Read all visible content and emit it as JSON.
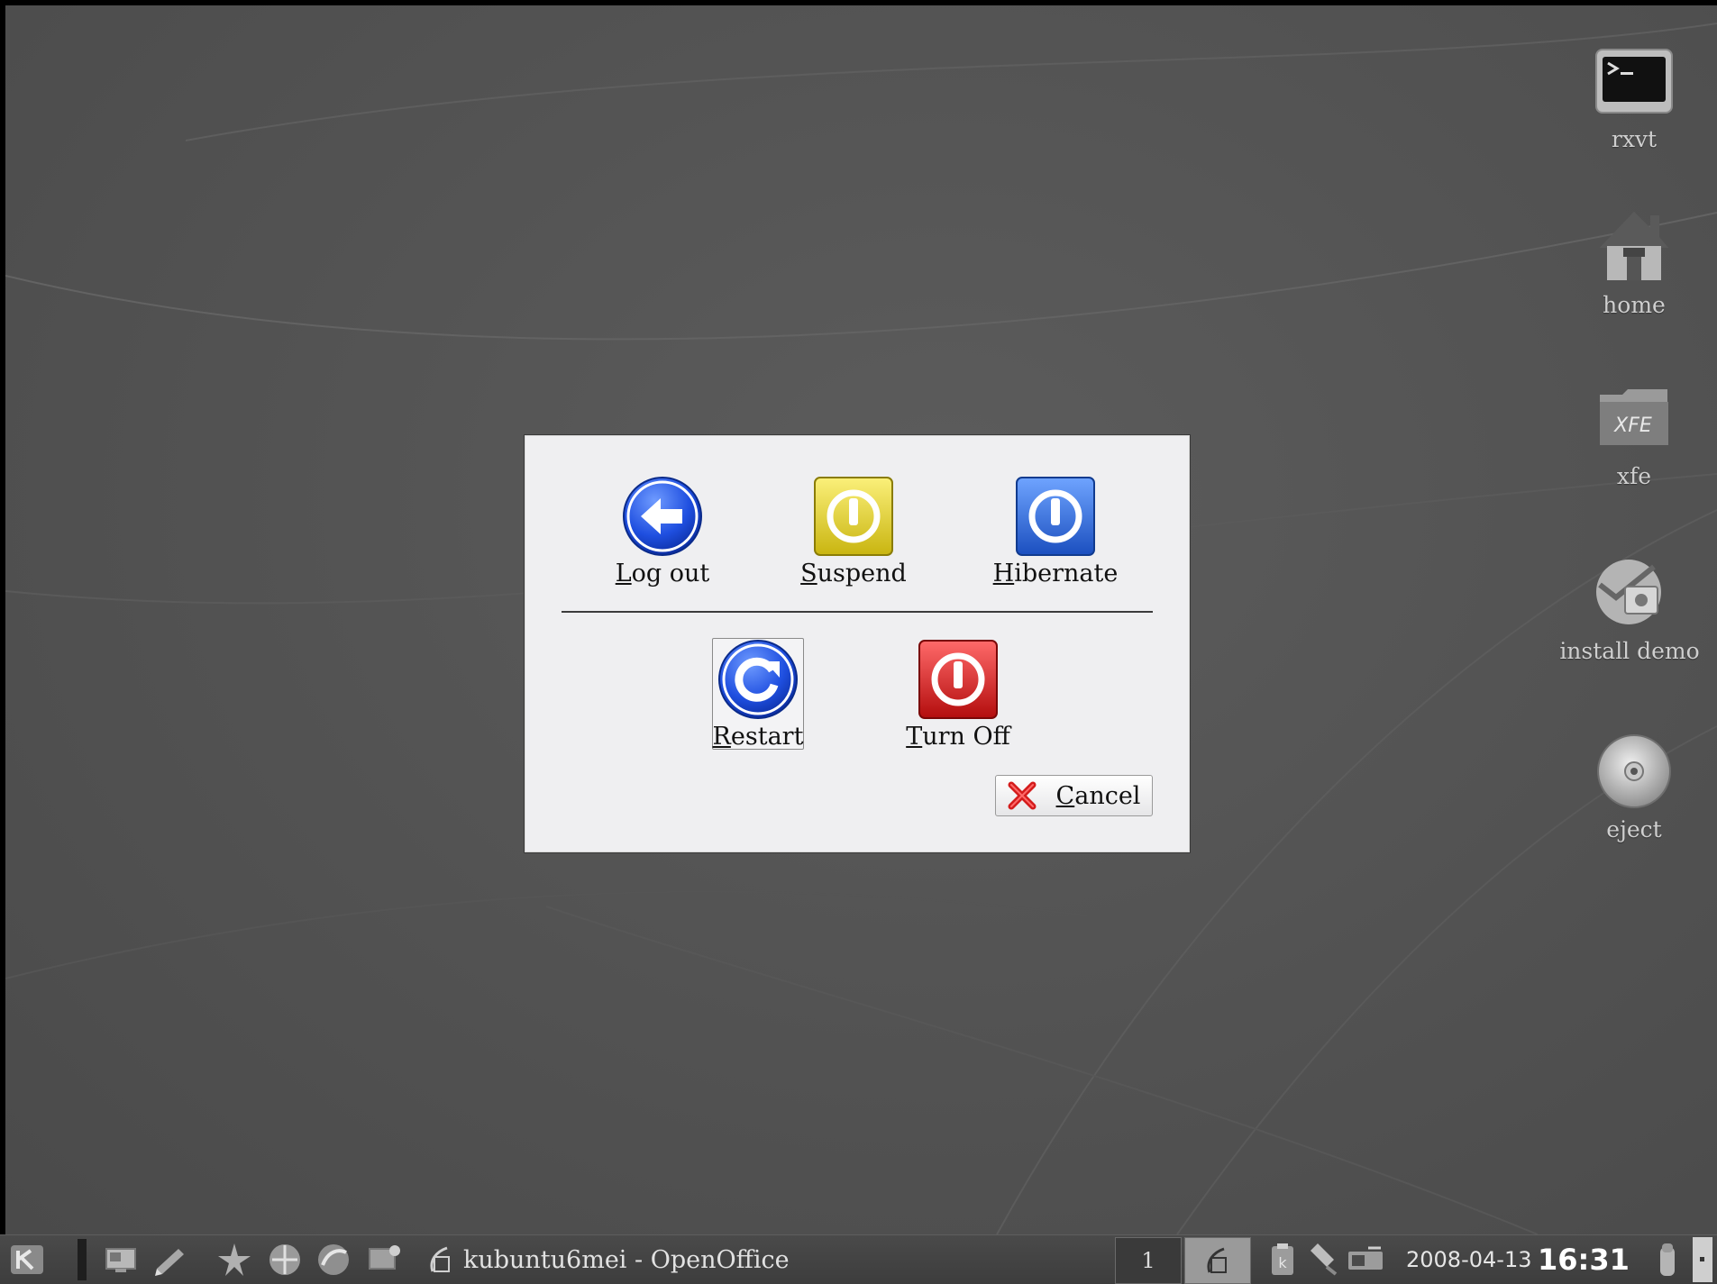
{
  "desktop": {
    "icons": [
      {
        "label": "rxvt",
        "icon": "terminal-icon"
      },
      {
        "label": "home",
        "icon": "home-icon"
      },
      {
        "label": "xfe",
        "icon": "xfe-folder-icon"
      },
      {
        "label": "install demo",
        "icon": "install-icon"
      },
      {
        "label": "eject",
        "icon": "cdrom-icon"
      }
    ],
    "xfe_badge": "XFE"
  },
  "dialog": {
    "actions": {
      "logout": {
        "accel": "L",
        "rest": "og out",
        "icon": "arrow-left-icon",
        "color": "#2255dd"
      },
      "suspend": {
        "accel": "S",
        "rest": "uspend",
        "icon": "power-icon",
        "color": "#e6d21a"
      },
      "hibernate": {
        "accel": "H",
        "rest": "ibernate",
        "icon": "power-icon",
        "color": "#2f6fd6"
      },
      "restart": {
        "accel": "R",
        "rest": "estart",
        "icon": "restart-icon",
        "color": "#2255dd"
      },
      "turnoff": {
        "accel": "T",
        "rest": "urn Off",
        "icon": "power-icon",
        "color": "#d42020"
      }
    },
    "cancel": {
      "accel": "C",
      "rest": "ancel",
      "icon": "red-x-icon"
    }
  },
  "taskbar": {
    "task_label": "kubuntu6mei - OpenOffice",
    "pager_desktop": "1",
    "date": "2008-04-13",
    "time": "16:31"
  }
}
